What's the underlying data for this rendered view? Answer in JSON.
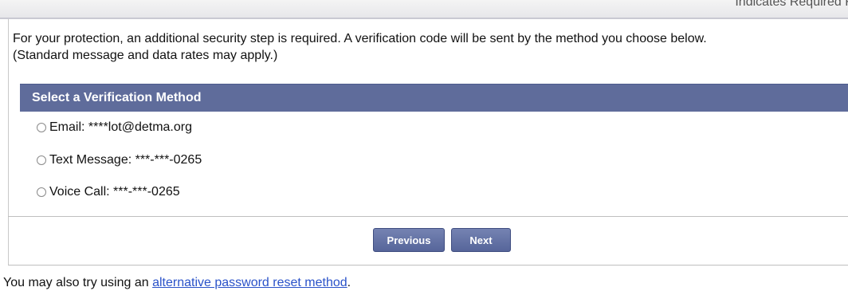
{
  "header": {
    "required_note": "Indicates Required F"
  },
  "intro": {
    "line1": "For your protection, an additional security step is required. A verification code will be sent by the method you choose below.",
    "line2": "(Standard message and data rates may apply.)"
  },
  "section": {
    "title": "Select a Verification Method"
  },
  "options": [
    {
      "label": "Email: ****lot@detma.org",
      "selected": false
    },
    {
      "label": "Text Message: ***-***-0265",
      "selected": false
    },
    {
      "label": "Voice Call: ***-***-0265",
      "selected": false
    }
  ],
  "buttons": {
    "previous_label": "Previous",
    "next_label": "Next"
  },
  "footer": {
    "prefix": "You may also try using an ",
    "link_text": "alternative password reset method",
    "suffix": "."
  },
  "colors": {
    "section_header_bg": "#5f6c9b",
    "button_bg": "#5f6c9b",
    "link": "#2a52c9"
  }
}
